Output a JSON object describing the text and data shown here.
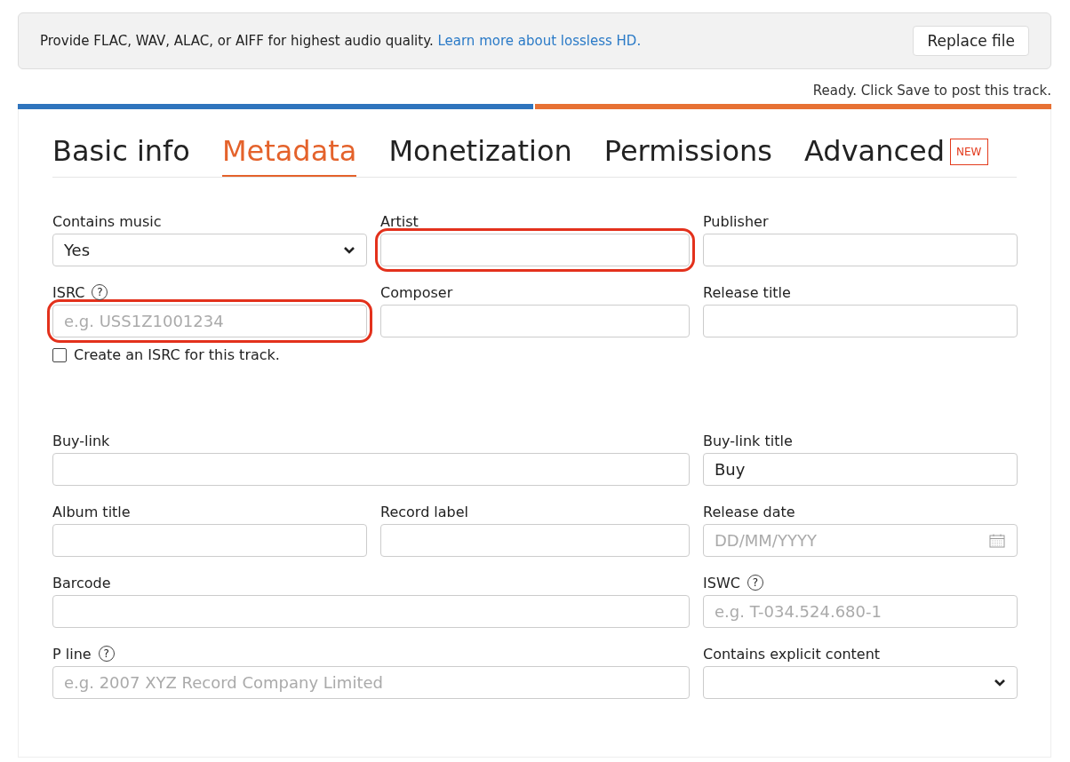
{
  "notice": {
    "text": "Provide FLAC, WAV, ALAC, or AIFF for highest audio quality.",
    "link": "Learn more about lossless HD.",
    "button": "Replace file"
  },
  "status": "Ready. Click Save to post this track.",
  "progress": {
    "level": 0.5
  },
  "tabs": [
    {
      "label": "Basic info",
      "selected": false
    },
    {
      "label": "Metadata",
      "selected": true
    },
    {
      "label": "Monetization",
      "selected": false
    },
    {
      "label": "Permissions",
      "selected": false
    },
    {
      "label": "Advanced",
      "selected": false,
      "badge": "NEW"
    }
  ],
  "sections": [
    {
      "rows": [
        [
          {
            "kind": "select",
            "label": "Contains music",
            "value": "Yes"
          },
          {
            "kind": "text",
            "label": "Artist",
            "highlighted": true
          },
          {
            "kind": "text",
            "label": "Publisher"
          }
        ],
        [
          {
            "kind": "text",
            "label": "ISRC",
            "help": "?",
            "placeholder": "e.g. USS1Z1001234",
            "highlighted": true
          },
          {
            "kind": "text",
            "label": "Composer"
          },
          {
            "kind": "text",
            "label": "Release title"
          }
        ],
        [
          {
            "kind": "checkbox",
            "label": "Create an ISRC for this track.",
            "checked": false
          }
        ]
      ]
    },
    {
      "rows": [
        [
          {
            "kind": "text",
            "label": "Buy-link"
          },
          {
            "kind": "text",
            "label": "Buy-link title",
            "value": "Buy"
          }
        ],
        [
          {
            "kind": "text",
            "label": "Album title"
          },
          {
            "kind": "text",
            "label": "Record label"
          },
          {
            "kind": "date",
            "label": "Release date",
            "placeholder": "DD/MM/YYYY"
          }
        ],
        [
          {
            "kind": "text",
            "label": "Barcode"
          },
          {
            "kind": "text",
            "label": "ISWC",
            "help": "?",
            "placeholder": "e.g. T-034.524.680-1"
          }
        ],
        [
          {
            "kind": "text",
            "label": "P line",
            "help": "?",
            "placeholder": "e.g. 2007 XYZ Record Company Limited"
          },
          {
            "kind": "select",
            "label": "Contains explicit content"
          }
        ]
      ]
    }
  ]
}
